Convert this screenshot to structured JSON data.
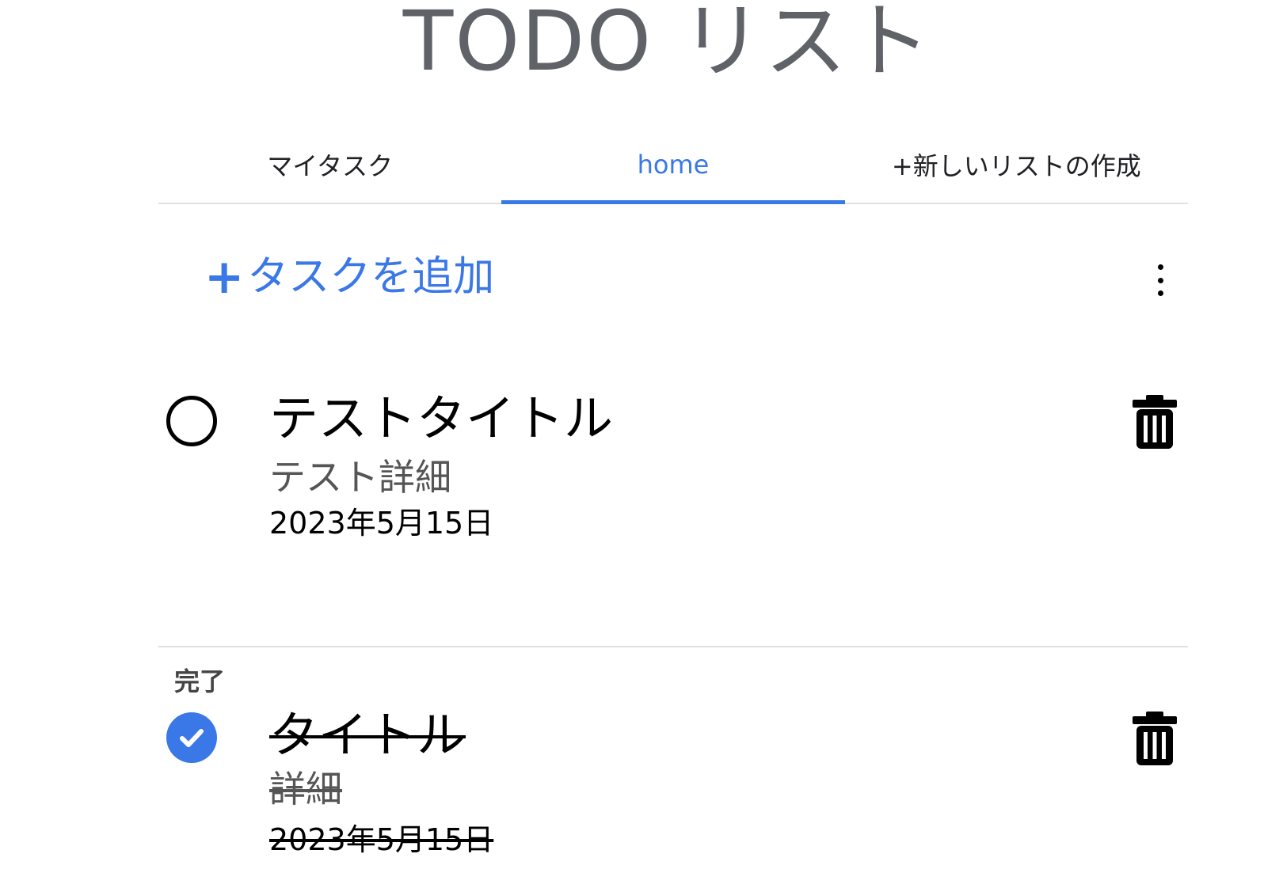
{
  "app": {
    "title": "TODO リスト"
  },
  "tabs": [
    {
      "label": "マイタスク",
      "active": false
    },
    {
      "label": "home",
      "active": true
    },
    {
      "label": "+新しいリストの作成",
      "active": false
    }
  ],
  "toolbar": {
    "add_plus": "+",
    "add_label": "タスクを追加",
    "more_icon": "more-vert-icon"
  },
  "tasks": [
    {
      "title": "テストタイトル",
      "detail": "テスト詳細",
      "date": "2023年5月15日",
      "completed": false
    }
  ],
  "completed_section": {
    "label": "完了",
    "tasks": [
      {
        "title": "タイトル",
        "detail": "詳細",
        "date": "2023年5月15日",
        "completed": true
      }
    ]
  },
  "colors": {
    "accent": "#3b78e7",
    "title_gray": "#5f6368",
    "divider": "#e0e0e0"
  }
}
